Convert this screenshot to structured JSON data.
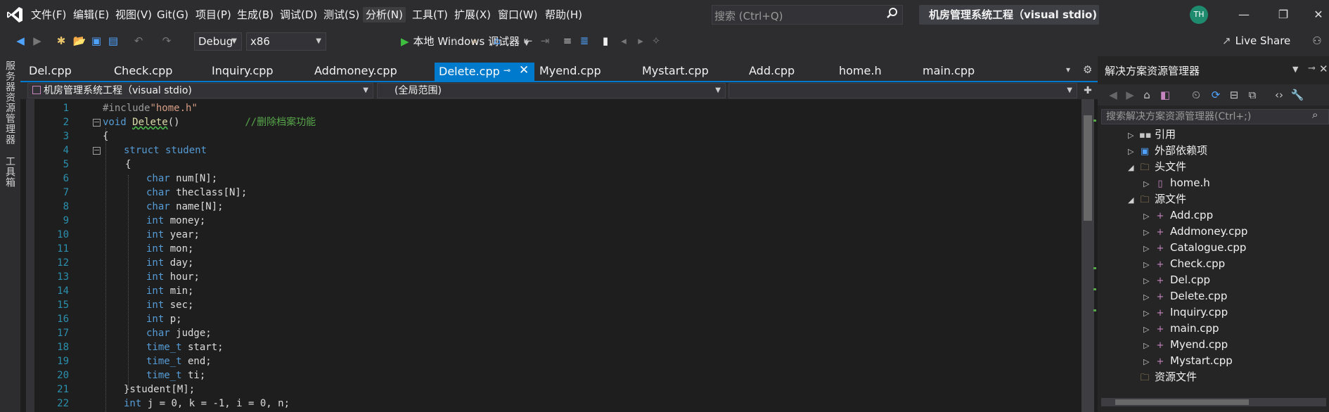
{
  "menu": [
    "文件(F)",
    "编辑(E)",
    "视图(V)",
    "Git(G)",
    "项目(P)",
    "生成(B)",
    "调试(D)",
    "测试(S)",
    "分析(N)",
    "工具(T)",
    "扩展(X)",
    "窗口(W)",
    "帮助(H)"
  ],
  "search": {
    "placeholder": "搜索 (Ctrl+Q)"
  },
  "solution_title": "机房管理系统工程（visual stdio)",
  "avatar": "TH",
  "toolbar": {
    "config": "Debug",
    "platform": "x86",
    "run_label": "本地 Windows 调试器",
    "live_share": "Live Share"
  },
  "left_tabs": [
    "服务器资源管理器",
    "工具箱"
  ],
  "tabs": [
    "Del.cpp",
    "Check.cpp",
    "Inquiry.cpp",
    "Addmoney.cpp",
    "Delete.cpp",
    "Myend.cpp",
    "Mystart.cpp",
    "Add.cpp",
    "home.h",
    "main.cpp"
  ],
  "active_tab": "Delete.cpp",
  "nav": {
    "project": "机房管理系统工程（visual stdio)",
    "scope": "(全局范围)"
  },
  "line_numbers": [
    "1",
    "2",
    "3",
    "4",
    "5",
    "6",
    "7",
    "8",
    "9",
    "10",
    "11",
    "12",
    "13",
    "14",
    "15",
    "16",
    "17",
    "18",
    "19",
    "20",
    "21",
    "22"
  ],
  "code": {
    "l1_pp": "#include",
    "l1_str": "\"home.h\"",
    "l2_kw": "void",
    "l2_fn": "Delete",
    "l2_rest": "()",
    "l2_cm": "//删除档案功能",
    "l3": "{",
    "l4_kw": "struct",
    "l4_rest": " student",
    "l5": "{",
    "fields": [
      {
        "kw": "char",
        "rest": " num[N];"
      },
      {
        "kw": "char",
        "rest": " theclass[N];"
      },
      {
        "kw": "char",
        "rest": " name[N];"
      },
      {
        "kw": "int",
        "rest": " money;"
      },
      {
        "kw": "int",
        "rest": " year;"
      },
      {
        "kw": "int",
        "rest": " mon;"
      },
      {
        "kw": "int",
        "rest": " day;"
      },
      {
        "kw": "int",
        "rest": " hour;"
      },
      {
        "kw": "int",
        "rest": " min;"
      },
      {
        "kw": "int",
        "rest": " sec;"
      },
      {
        "kw": "int",
        "rest": " p;"
      },
      {
        "kw": "char",
        "rest": " judge;"
      },
      {
        "kw": "time_t",
        "rest": " start;"
      },
      {
        "kw": "time_t",
        "rest": " end;"
      },
      {
        "kw": "time_t",
        "rest": " ti;"
      }
    ],
    "l21": "}student[M];",
    "l22_kw": "int",
    "l22_rest": " j = 0, k = -1, i = 0, n;"
  },
  "solution_explorer": {
    "header": "解决方案资源管理器",
    "search_placeholder": "搜索解决方案资源管理器(Ctrl+;)",
    "items": [
      {
        "label": "引用",
        "icon": "references-icon"
      },
      {
        "label": "外部依赖项",
        "icon": "external-deps-icon"
      },
      {
        "label": "头文件",
        "icon": "folder-icon"
      },
      {
        "label": "home.h",
        "icon": "header-file-icon"
      },
      {
        "label": "源文件",
        "icon": "folder-icon"
      },
      {
        "label": "Add.cpp",
        "icon": "cpp-file-icon"
      },
      {
        "label": "Addmoney.cpp",
        "icon": "cpp-file-icon"
      },
      {
        "label": "Catalogue.cpp",
        "icon": "cpp-file-icon"
      },
      {
        "label": "Check.cpp",
        "icon": "cpp-file-icon"
      },
      {
        "label": "Del.cpp",
        "icon": "cpp-file-icon"
      },
      {
        "label": "Delete.cpp",
        "icon": "cpp-file-icon"
      },
      {
        "label": "Inquiry.cpp",
        "icon": "cpp-file-icon"
      },
      {
        "label": "main.cpp",
        "icon": "cpp-file-icon"
      },
      {
        "label": "Myend.cpp",
        "icon": "cpp-file-icon"
      },
      {
        "label": "Mystart.cpp",
        "icon": "cpp-file-icon"
      },
      {
        "label": "资源文件",
        "icon": "folder-icon"
      }
    ]
  },
  "colors": {
    "accent": "#007acc",
    "keyword": "#569cd6",
    "comment": "#57a64a",
    "string": "#d69d85",
    "line_number": "#2b91af"
  }
}
